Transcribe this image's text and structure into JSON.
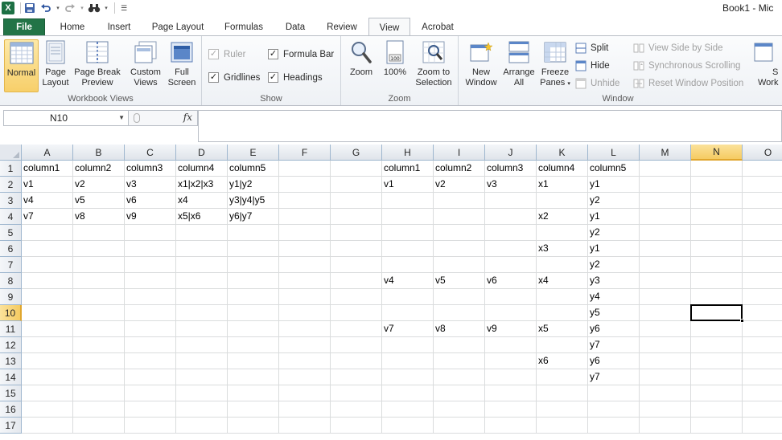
{
  "window_title": "Book1 - Mic",
  "qat": {
    "excel_logo": "X",
    "save_icon": "save-icon",
    "undo_icon": "undo-icon",
    "redo_icon": "redo-icon",
    "find_icon": "binoculars-icon",
    "customize_icon": "customize-qat-icon"
  },
  "tabs": [
    {
      "label": "File"
    },
    {
      "label": "Home"
    },
    {
      "label": "Insert"
    },
    {
      "label": "Page Layout"
    },
    {
      "label": "Formulas"
    },
    {
      "label": "Data"
    },
    {
      "label": "Review"
    },
    {
      "label": "View"
    },
    {
      "label": "Acrobat"
    }
  ],
  "ribbon": {
    "workbook_views": {
      "label": "Workbook Views",
      "normal_l1": "Normal",
      "page_layout_l1": "Page",
      "page_layout_l2": "Layout",
      "page_break_l1": "Page Break",
      "page_break_l2": "Preview",
      "custom_views_l1": "Custom",
      "custom_views_l2": "Views",
      "full_screen_l1": "Full",
      "full_screen_l2": "Screen"
    },
    "show": {
      "label": "Show",
      "ruler": "Ruler",
      "formula_bar": "Formula Bar",
      "gridlines": "Gridlines",
      "headings": "Headings",
      "ruler_checked": true,
      "formula_bar_checked": true,
      "gridlines_checked": true,
      "headings_checked": true
    },
    "zoom": {
      "label": "Zoom",
      "zoom": "Zoom",
      "hundred": "100%",
      "zoom_to_l1": "Zoom to",
      "zoom_to_l2": "Selection"
    },
    "window": {
      "label": "Window",
      "new_window_l1": "New",
      "new_window_l2": "Window",
      "arrange_l1": "Arrange",
      "arrange_l2": "All",
      "freeze_l1": "Freeze",
      "freeze_l2": "Panes",
      "split": "Split",
      "hide": "Hide",
      "unhide": "Unhide",
      "side_by_side": "View Side by Side",
      "sync_scrolling": "Synchronous Scrolling",
      "reset_position": "Reset Window Position",
      "save_ws_l1": "S",
      "save_ws_l2": "Work"
    }
  },
  "formula_bar": {
    "name_box": "N10",
    "fx": "fx",
    "formula": ""
  },
  "columns": [
    "A",
    "B",
    "C",
    "D",
    "E",
    "F",
    "G",
    "H",
    "I",
    "J",
    "K",
    "L",
    "M",
    "N",
    "O"
  ],
  "rows": [
    "1",
    "2",
    "3",
    "4",
    "5",
    "6",
    "7",
    "8",
    "9",
    "10",
    "11",
    "12",
    "13",
    "14",
    "15",
    "16",
    "17"
  ],
  "active_cell": {
    "column": "N",
    "row": "10"
  },
  "cells": {
    "1": {
      "A": "column1",
      "B": "column2",
      "C": "column3",
      "D": "column4",
      "E": "column5",
      "H": "column1",
      "I": "column2",
      "J": "column3",
      "K": "column4",
      "L": "column5"
    },
    "2": {
      "A": "v1",
      "B": "v2",
      "C": "v3",
      "D": "x1|x2|x3",
      "E": "y1|y2",
      "H": "v1",
      "I": "v2",
      "J": "v3",
      "K": "x1",
      "L": "y1"
    },
    "3": {
      "A": "v4",
      "B": "v5",
      "C": "v6",
      "D": "x4",
      "E": "y3|y4|y5",
      "L": "y2"
    },
    "4": {
      "A": "v7",
      "B": "v8",
      "C": "v9",
      "D": "x5|x6",
      "E": "y6|y7",
      "K": "x2",
      "L": "y1"
    },
    "5": {
      "L": "y2"
    },
    "6": {
      "K": "x3",
      "L": "y1"
    },
    "7": {
      "L": "y2"
    },
    "8": {
      "H": "v4",
      "I": "v5",
      "J": "v6",
      "K": "x4",
      "L": "y3"
    },
    "9": {
      "L": "y4"
    },
    "10": {
      "L": "y5"
    },
    "11": {
      "H": "v7",
      "I": "v8",
      "J": "v9",
      "K": "x5",
      "L": "y6"
    },
    "12": {
      "L": "y7"
    },
    "13": {
      "K": "x6",
      "L": "y6"
    },
    "14": {
      "L": "y7"
    }
  }
}
